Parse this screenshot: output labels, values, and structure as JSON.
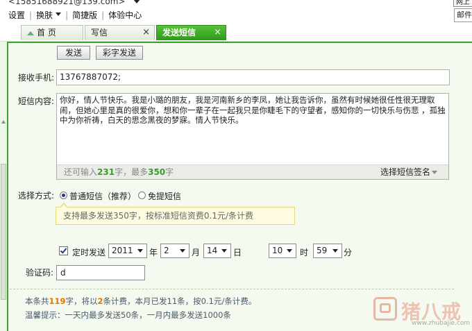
{
  "header": {
    "account_email": "<15851688921@139.com>",
    "menu": [
      "设置",
      "换肤",
      "简捷版",
      "体验中心"
    ],
    "right_button_1": "网上",
    "right_button_2": "邮件"
  },
  "tabs": [
    {
      "label": "首 页",
      "active": false
    },
    {
      "label": "写信",
      "active": false
    },
    {
      "label": "发送短信",
      "active": true
    }
  ],
  "toolbar": {
    "send_label": "发送",
    "mms_label": "彩字发送"
  },
  "form": {
    "recipient_label": "接收手机:",
    "recipient_value": "13767887072;",
    "content_label": "短信内容:",
    "content_text": "你好，情人节快乐。我是小璐的朋友，我是河南新乡的李凤，她让我告诉你，虽然有时候她很任性很无理取闹，但她心里是真的很爱你，想和你一辈子在一起我只是你睫毛下的守望者，感知你的一切快乐与伤悲 ，孤独中为你祈祷，白天的思念黑夜的梦寐。情人节快乐。",
    "remaining_prefix": "还可输入",
    "remaining_count": "231",
    "remaining_mid": "字，最多",
    "max_count": "350",
    "remaining_suffix": "字",
    "signature_label": "选择短信签名",
    "method_label": "选择方式:",
    "method_options": [
      {
        "label": "普通短信（推荐）",
        "selected": true
      },
      {
        "label": "免提短信",
        "selected": false
      }
    ],
    "method_tip": "支持最多发送350字，按标准短信资费0.1元/条计费",
    "schedule_checked": true,
    "schedule_label": "定时发送",
    "year": "2011",
    "year_unit": "年",
    "month": "2",
    "month_unit": "月",
    "day": "14",
    "day_unit": "日",
    "hour": "10",
    "hour_unit": "时",
    "minute": "59",
    "minute_unit": "分",
    "captcha_label": "验证码:",
    "captcha_value": "d"
  },
  "footer": {
    "line1_a": "本条共",
    "char_count": "119",
    "line1_b": "字，将以",
    "msg_count": "2",
    "line1_c": "条计费，本月已发11条，按0.1元/条计费。",
    "line2": "温馨提示：一天内最多发送50条，一月内最多发送1000条"
  },
  "watermark": {
    "brand": "猪八戒",
    "url": "www.zhubajie.com"
  }
}
